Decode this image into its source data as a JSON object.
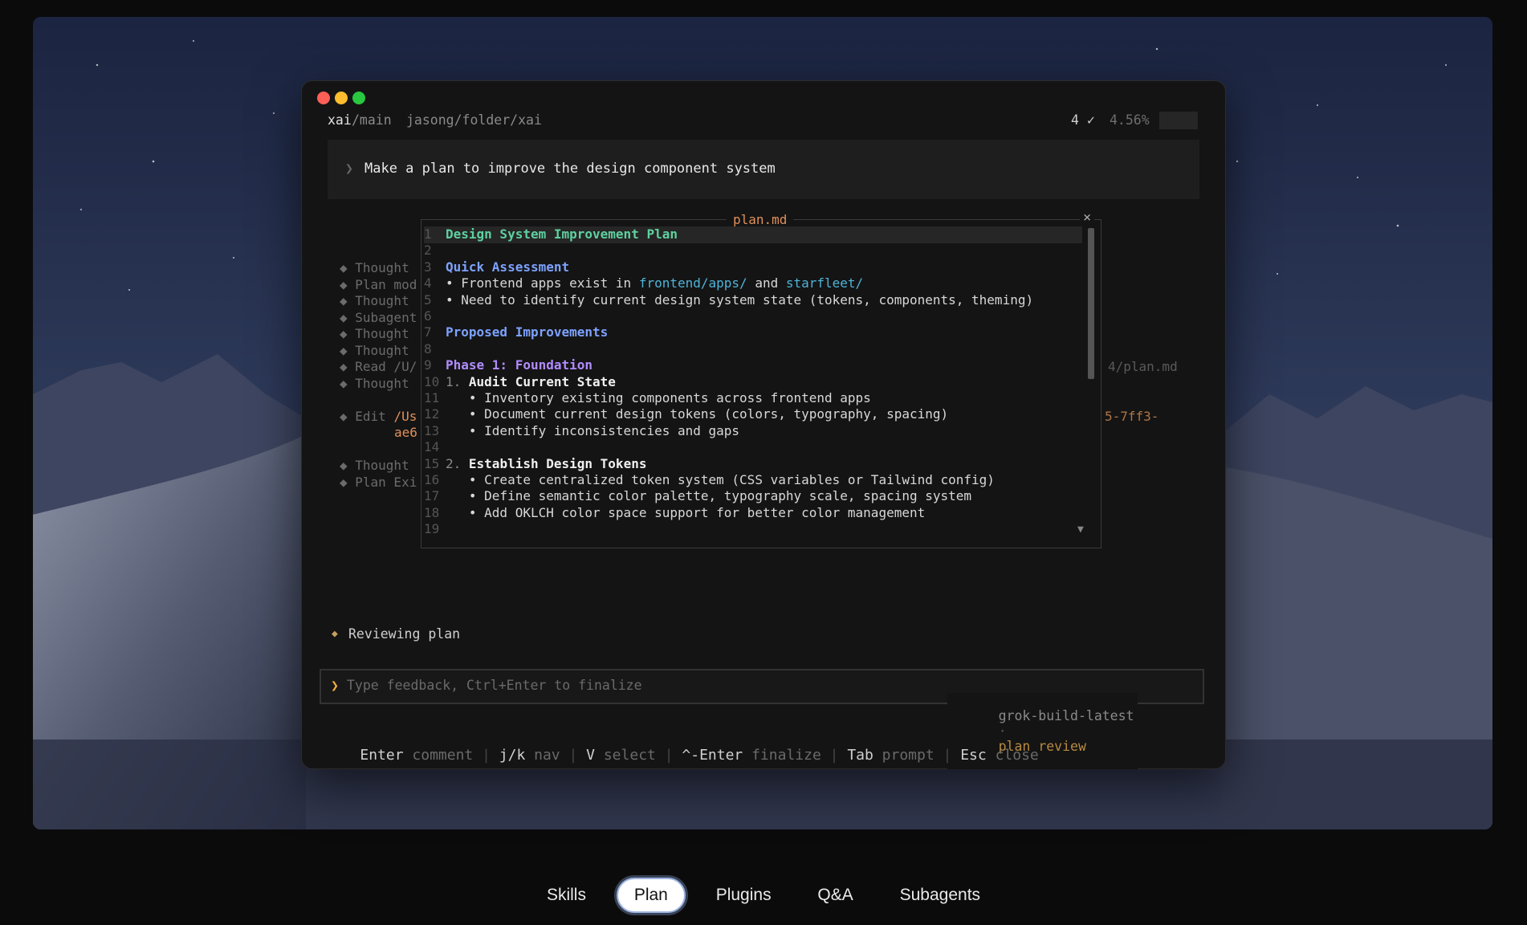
{
  "terminal": {
    "branch_repo": "xai",
    "branch_name": "/main",
    "path": "jasong/folder/xai",
    "count": "4 ✓",
    "percent": "4.56%",
    "prompt_chevron": "❯",
    "prompt_text": "Make a plan to improve the design component system"
  },
  "sidebar": {
    "items": [
      {
        "label": "◆ Thought"
      },
      {
        "label": "◆ Plan mod"
      },
      {
        "label": "◆ Thought"
      },
      {
        "label": "◆ Subagent"
      },
      {
        "label": "◆ Thought"
      },
      {
        "label": "◆ Thought"
      },
      {
        "label": "◆ Read /U/"
      },
      {
        "label": "◆ Thought"
      },
      {
        "label": "◆ Edit ",
        "path": "/Us"
      },
      {
        "label": "",
        "path": "ae6"
      },
      {
        "label": "◆ Thought"
      },
      {
        "label": "◆ Plan Exi"
      }
    ],
    "right_read": "4/plan.md",
    "right_edit": "5-7ff3-"
  },
  "modal": {
    "title": "plan.md",
    "close": "×",
    "scroll_down": "▼",
    "lines": [
      {
        "n": "1",
        "parts": [
          {
            "t": "Design System Improvement Plan",
            "c": "green"
          }
        ]
      },
      {
        "n": "2",
        "parts": []
      },
      {
        "n": "3",
        "parts": [
          {
            "t": "Quick Assessment",
            "c": "blue"
          }
        ]
      },
      {
        "n": "4",
        "parts": [
          {
            "t": "• Frontend apps exist in ",
            "c": "text"
          },
          {
            "t": "frontend/apps/",
            "c": "cyan"
          },
          {
            "t": " and ",
            "c": "text"
          },
          {
            "t": "starfleet/",
            "c": "cyan"
          }
        ]
      },
      {
        "n": "5",
        "parts": [
          {
            "t": "• Need to identify current design system state (tokens, components, theming)",
            "c": "text"
          }
        ]
      },
      {
        "n": "6",
        "parts": []
      },
      {
        "n": "7",
        "parts": [
          {
            "t": "Proposed Improvements",
            "c": "blue"
          }
        ]
      },
      {
        "n": "8",
        "parts": []
      },
      {
        "n": "9",
        "parts": [
          {
            "t": "Phase 1: Foundation",
            "c": "purple"
          }
        ]
      },
      {
        "n": "10",
        "parts": [
          {
            "t": "1. ",
            "c": "dim"
          },
          {
            "t": "Audit Current State",
            "c": "bold"
          }
        ]
      },
      {
        "n": "11",
        "parts": [
          {
            "t": "   • Inventory existing components across frontend apps",
            "c": "text"
          }
        ]
      },
      {
        "n": "12",
        "parts": [
          {
            "t": "   • Document current design tokens (colors, typography, spacing)",
            "c": "text"
          }
        ]
      },
      {
        "n": "13",
        "parts": [
          {
            "t": "   • Identify inconsistencies and gaps",
            "c": "text"
          }
        ]
      },
      {
        "n": "14",
        "parts": []
      },
      {
        "n": "15",
        "parts": [
          {
            "t": "2. ",
            "c": "dim"
          },
          {
            "t": "Establish Design Tokens",
            "c": "bold"
          }
        ]
      },
      {
        "n": "16",
        "parts": [
          {
            "t": "   • Create centralized token system (CSS variables or Tailwind config)",
            "c": "text"
          }
        ]
      },
      {
        "n": "17",
        "parts": [
          {
            "t": "   • Define semantic color palette, typography scale, spacing system",
            "c": "text"
          }
        ]
      },
      {
        "n": "18",
        "parts": [
          {
            "t": "   • Add OKLCH color space support for better color management",
            "c": "text"
          }
        ]
      },
      {
        "n": "19",
        "parts": []
      }
    ]
  },
  "status": {
    "diamond": "◆",
    "text": "Reviewing plan"
  },
  "feedback": {
    "chevron": "❯",
    "placeholder": "Type feedback, Ctrl+Enter to finalize",
    "model": "grok-build-latest",
    "separator": "·",
    "mode": "plan review"
  },
  "hints": [
    {
      "key": "Enter",
      "action": "comment"
    },
    {
      "key": "j/k",
      "action": "nav"
    },
    {
      "key": "V",
      "action": "select"
    },
    {
      "key": "^-Enter",
      "action": "finalize"
    },
    {
      "key": "Tab",
      "action": "prompt"
    },
    {
      "key": "Esc",
      "action": "close"
    }
  ],
  "tabs": [
    {
      "label": "Skills",
      "active": false
    },
    {
      "label": "Plan",
      "active": true
    },
    {
      "label": "Plugins",
      "active": false
    },
    {
      "label": "Q&A",
      "active": false
    },
    {
      "label": "Subagents",
      "active": false
    }
  ],
  "colors": {
    "green": "#5fd0a0",
    "blue": "#7da2ff",
    "cyan": "#4fb3d9",
    "purple": "#b18cff",
    "orange": "#e0905a",
    "text": "#d8d8d8",
    "dim": "#8a8a8a"
  }
}
